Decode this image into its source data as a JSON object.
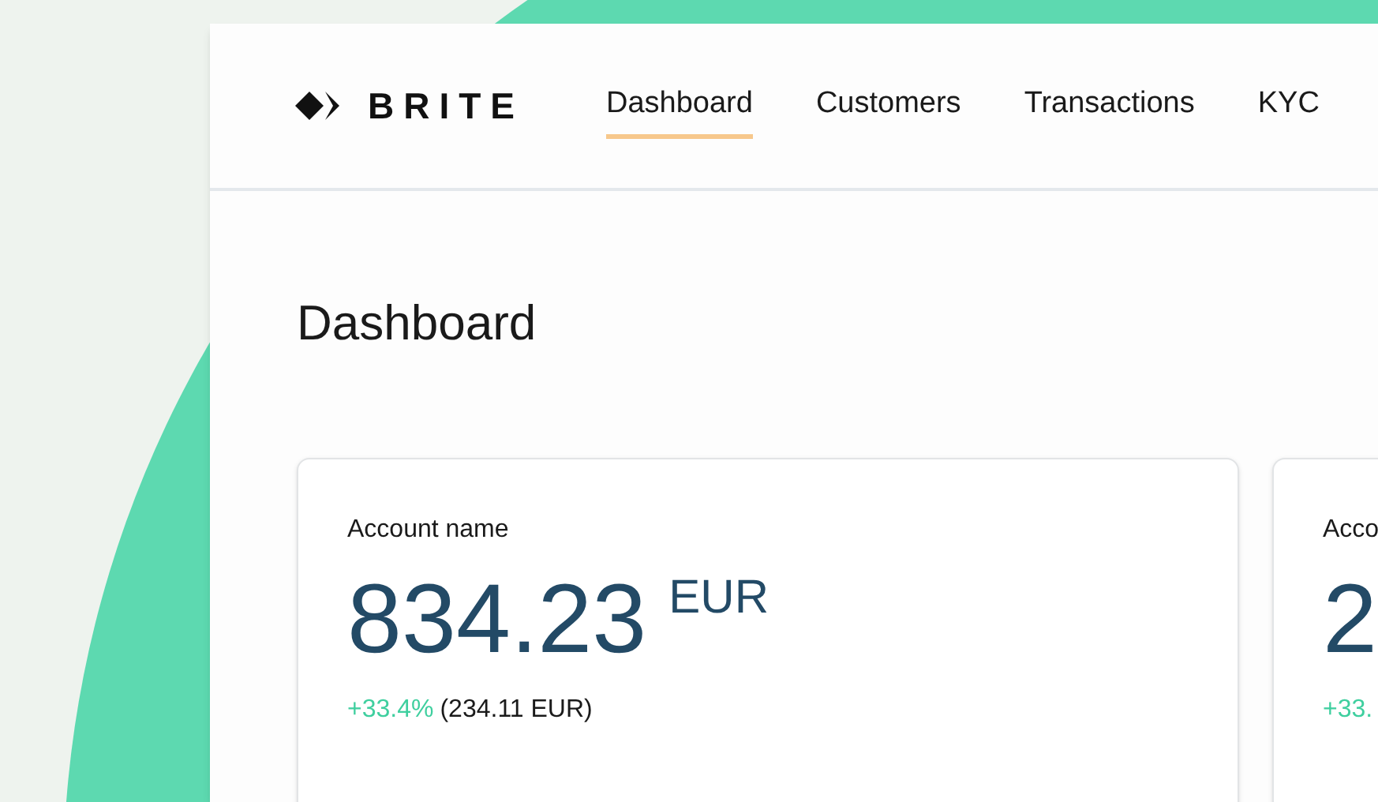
{
  "brand": {
    "name": "BRITE"
  },
  "nav": [
    {
      "label": "Dashboard",
      "selected": true
    },
    {
      "label": "Customers",
      "selected": false
    },
    {
      "label": "Transactions",
      "selected": false
    },
    {
      "label": "KYC",
      "selected": false
    }
  ],
  "page_title": "Dashboard",
  "cards": [
    {
      "label": "Account name",
      "amount": "834.23",
      "currency": "EUR",
      "change": "+33.4%",
      "change_amount": "(234.11 EUR)"
    },
    {
      "label": "Acco",
      "amount": "2",
      "change": "+33."
    }
  ]
}
